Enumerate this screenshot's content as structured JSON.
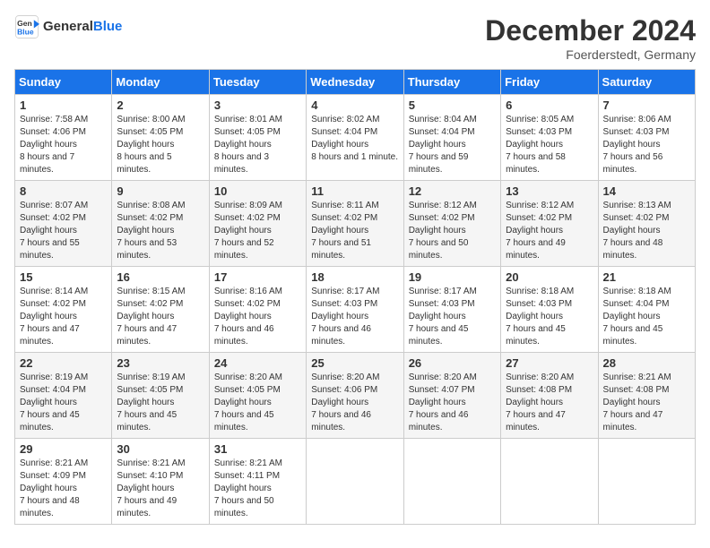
{
  "header": {
    "logo_line1": "General",
    "logo_line2": "Blue",
    "month": "December 2024",
    "location": "Foerderstedt, Germany"
  },
  "days_of_week": [
    "Sunday",
    "Monday",
    "Tuesday",
    "Wednesday",
    "Thursday",
    "Friday",
    "Saturday"
  ],
  "weeks": [
    [
      {
        "day": "1",
        "sunrise": "7:58 AM",
        "sunset": "4:06 PM",
        "daylight": "8 hours and 7 minutes."
      },
      {
        "day": "2",
        "sunrise": "8:00 AM",
        "sunset": "4:05 PM",
        "daylight": "8 hours and 5 minutes."
      },
      {
        "day": "3",
        "sunrise": "8:01 AM",
        "sunset": "4:05 PM",
        "daylight": "8 hours and 3 minutes."
      },
      {
        "day": "4",
        "sunrise": "8:02 AM",
        "sunset": "4:04 PM",
        "daylight": "8 hours and 1 minute."
      },
      {
        "day": "5",
        "sunrise": "8:04 AM",
        "sunset": "4:04 PM",
        "daylight": "7 hours and 59 minutes."
      },
      {
        "day": "6",
        "sunrise": "8:05 AM",
        "sunset": "4:03 PM",
        "daylight": "7 hours and 58 minutes."
      },
      {
        "day": "7",
        "sunrise": "8:06 AM",
        "sunset": "4:03 PM",
        "daylight": "7 hours and 56 minutes."
      }
    ],
    [
      {
        "day": "8",
        "sunrise": "8:07 AM",
        "sunset": "4:02 PM",
        "daylight": "7 hours and 55 minutes."
      },
      {
        "day": "9",
        "sunrise": "8:08 AM",
        "sunset": "4:02 PM",
        "daylight": "7 hours and 53 minutes."
      },
      {
        "day": "10",
        "sunrise": "8:09 AM",
        "sunset": "4:02 PM",
        "daylight": "7 hours and 52 minutes."
      },
      {
        "day": "11",
        "sunrise": "8:11 AM",
        "sunset": "4:02 PM",
        "daylight": "7 hours and 51 minutes."
      },
      {
        "day": "12",
        "sunrise": "8:12 AM",
        "sunset": "4:02 PM",
        "daylight": "7 hours and 50 minutes."
      },
      {
        "day": "13",
        "sunrise": "8:12 AM",
        "sunset": "4:02 PM",
        "daylight": "7 hours and 49 minutes."
      },
      {
        "day": "14",
        "sunrise": "8:13 AM",
        "sunset": "4:02 PM",
        "daylight": "7 hours and 48 minutes."
      }
    ],
    [
      {
        "day": "15",
        "sunrise": "8:14 AM",
        "sunset": "4:02 PM",
        "daylight": "7 hours and 47 minutes."
      },
      {
        "day": "16",
        "sunrise": "8:15 AM",
        "sunset": "4:02 PM",
        "daylight": "7 hours and 47 minutes."
      },
      {
        "day": "17",
        "sunrise": "8:16 AM",
        "sunset": "4:02 PM",
        "daylight": "7 hours and 46 minutes."
      },
      {
        "day": "18",
        "sunrise": "8:17 AM",
        "sunset": "4:03 PM",
        "daylight": "7 hours and 46 minutes."
      },
      {
        "day": "19",
        "sunrise": "8:17 AM",
        "sunset": "4:03 PM",
        "daylight": "7 hours and 45 minutes."
      },
      {
        "day": "20",
        "sunrise": "8:18 AM",
        "sunset": "4:03 PM",
        "daylight": "7 hours and 45 minutes."
      },
      {
        "day": "21",
        "sunrise": "8:18 AM",
        "sunset": "4:04 PM",
        "daylight": "7 hours and 45 minutes."
      }
    ],
    [
      {
        "day": "22",
        "sunrise": "8:19 AM",
        "sunset": "4:04 PM",
        "daylight": "7 hours and 45 minutes."
      },
      {
        "day": "23",
        "sunrise": "8:19 AM",
        "sunset": "4:05 PM",
        "daylight": "7 hours and 45 minutes."
      },
      {
        "day": "24",
        "sunrise": "8:20 AM",
        "sunset": "4:05 PM",
        "daylight": "7 hours and 45 minutes."
      },
      {
        "day": "25",
        "sunrise": "8:20 AM",
        "sunset": "4:06 PM",
        "daylight": "7 hours and 46 minutes."
      },
      {
        "day": "26",
        "sunrise": "8:20 AM",
        "sunset": "4:07 PM",
        "daylight": "7 hours and 46 minutes."
      },
      {
        "day": "27",
        "sunrise": "8:20 AM",
        "sunset": "4:08 PM",
        "daylight": "7 hours and 47 minutes."
      },
      {
        "day": "28",
        "sunrise": "8:21 AM",
        "sunset": "4:08 PM",
        "daylight": "7 hours and 47 minutes."
      }
    ],
    [
      {
        "day": "29",
        "sunrise": "8:21 AM",
        "sunset": "4:09 PM",
        "daylight": "7 hours and 48 minutes."
      },
      {
        "day": "30",
        "sunrise": "8:21 AM",
        "sunset": "4:10 PM",
        "daylight": "7 hours and 49 minutes."
      },
      {
        "day": "31",
        "sunrise": "8:21 AM",
        "sunset": "4:11 PM",
        "daylight": "7 hours and 50 minutes."
      },
      null,
      null,
      null,
      null
    ]
  ]
}
